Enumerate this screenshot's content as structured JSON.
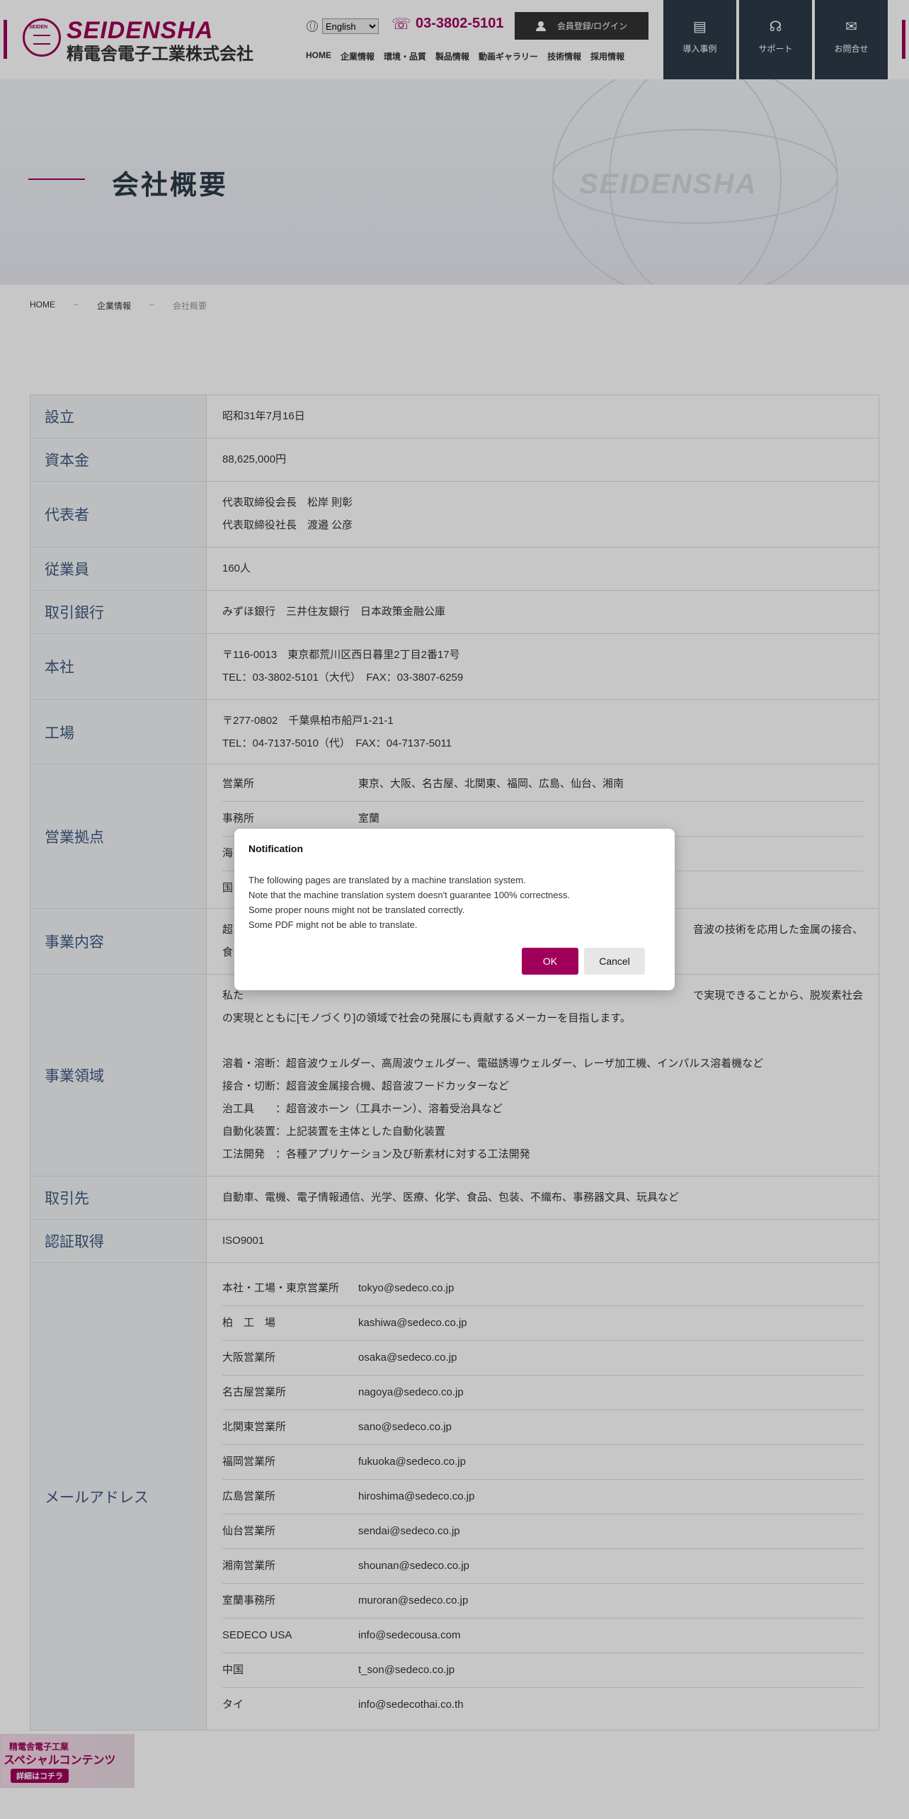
{
  "header": {
    "logo_en": "SEIDENSHA",
    "logo_ja": "精電舎電子工業株式会社",
    "logo_mark_text": "SEIDEN",
    "language_selected": "English",
    "phone": "03-3802-5101",
    "login_label": "会員登録/ログイン",
    "nav": [
      "HOME",
      "企業情報",
      "環境・品質",
      "製品情報",
      "動画ギャラリー",
      "技術情報",
      "採用情報"
    ],
    "buttons": [
      {
        "label": "導入事例",
        "icon": "case-study-icon"
      },
      {
        "label": "サポート",
        "icon": "headset-icon"
      },
      {
        "label": "お問合せ",
        "icon": "mail-icon"
      }
    ]
  },
  "hero": {
    "title": "会社概要",
    "watermark": "SEIDENSHA"
  },
  "breadcrumb": [
    "HOME",
    "企業情報",
    "会社概要"
  ],
  "table1": [
    {
      "label": "設立",
      "lines": [
        "昭和31年7月16日"
      ]
    },
    {
      "label": "資本金",
      "lines": [
        "88,625,000円"
      ]
    },
    {
      "label": "代表者",
      "lines": [
        "代表取締役会長　松岸 則彰",
        "代表取締役社長　渡邉 公彦"
      ]
    },
    {
      "label": "従業員",
      "lines": [
        "160人"
      ]
    },
    {
      "label": "取引銀行",
      "lines": [
        "みずほ銀行　三井住友銀行　日本政策金融公庫"
      ]
    },
    {
      "label": "本社",
      "lines": [
        "〒116-0013　東京都荒川区西日暮里2丁目2番17号",
        "TEL：03-3802-5101（大代）　FAX：03-3807-6259"
      ]
    },
    {
      "label": "工場",
      "lines": [
        "〒277-0802　千葉県柏市船戸1-21-1",
        "TEL：04-7137-5010（代）　FAX：04-7137-5011"
      ]
    }
  ],
  "sales": {
    "label": "営業拠点",
    "rows": [
      {
        "k": "営業所",
        "v": "東京、大阪、名古屋、北関東、福岡、広島、仙台、湘南"
      },
      {
        "k": "事務所",
        "v": "室蘭"
      },
      {
        "k": "海",
        "v": ""
      },
      {
        "k": "国",
        "v": ""
      }
    ]
  },
  "business": {
    "label": "事業内容",
    "line1_start": "超",
    "line1_end": "音波の技術を応用した金属の接合、",
    "line2": "食"
  },
  "domain": {
    "label": "事業領域",
    "intro_start": "私た",
    "intro_end": "で実現できることから、脱炭素社会",
    "intro2": "の実現とともに[モノづくり]の領域で社会の発展にも貢献するメーカーを目指します。",
    "items": [
      "溶着・溶断：超音波ウェルダー、高周波ウェルダー、電磁誘導ウェルダー、レーザ加工機、インパルス溶着機など",
      "接合・切断：超音波金属接合機、超音波フードカッターなど",
      "治工具　　：超音波ホーン（工具ホーン）、溶着受治具など",
      "自動化装置：上記装置を主体とした自動化装置",
      "工法開発　：各種アプリケーション及び新素材に対する工法開発"
    ]
  },
  "customers": {
    "label": "取引先",
    "value": "自動車、電機、電子情報通信、光学、医療、化学、食品、包装、不織布、事務器文具、玩具など"
  },
  "cert": {
    "label": "認証取得",
    "value": "ISO9001"
  },
  "mail": {
    "label": "メールアドレス",
    "rows": [
      {
        "k": "本社・工場・東京営業所",
        "v": "tokyo@sedeco.co.jp"
      },
      {
        "k": "柏　工　場",
        "v": "kashiwa@sedeco.co.jp"
      },
      {
        "k": "大阪営業所",
        "v": "osaka@sedeco.co.jp"
      },
      {
        "k": "名古屋営業所",
        "v": "nagoya@sedeco.co.jp"
      },
      {
        "k": "北関東営業所",
        "v": "sano@sedeco.co.jp"
      },
      {
        "k": "福岡営業所",
        "v": "fukuoka@sedeco.co.jp"
      },
      {
        "k": "広島営業所",
        "v": "hiroshima@sedeco.co.jp"
      },
      {
        "k": "仙台営業所",
        "v": "sendai@sedeco.co.jp"
      },
      {
        "k": "湘南営業所",
        "v": "shounan@sedeco.co.jp"
      },
      {
        "k": "室蘭事務所",
        "v": "muroran@sedeco.co.jp"
      },
      {
        "k": "SEDECO USA",
        "v": "info@sedecousa.com"
      },
      {
        "k": "中国",
        "v": "t_son@sedeco.co.jp"
      },
      {
        "k": "タイ",
        "v": "info@sedecothai.co.th"
      }
    ]
  },
  "dialog": {
    "title": "Notification",
    "lines": [
      "The following pages are translated by a machine translation system.",
      "Note that the machine translation system doesn't guarantee 100% correctness.",
      "Some proper nouns might not be translated correctly.",
      "Some PDF might not be able to translate."
    ],
    "ok": "OK",
    "cancel": "Cancel"
  },
  "banner": {
    "line1": "精電舎電子工業",
    "line2": "スペシャルコンテンツ",
    "line3": "詳細はコチラ"
  },
  "colors": {
    "brand": "#a0005a",
    "navy": "#2d3a47",
    "label_blue": "#3c5a82"
  }
}
